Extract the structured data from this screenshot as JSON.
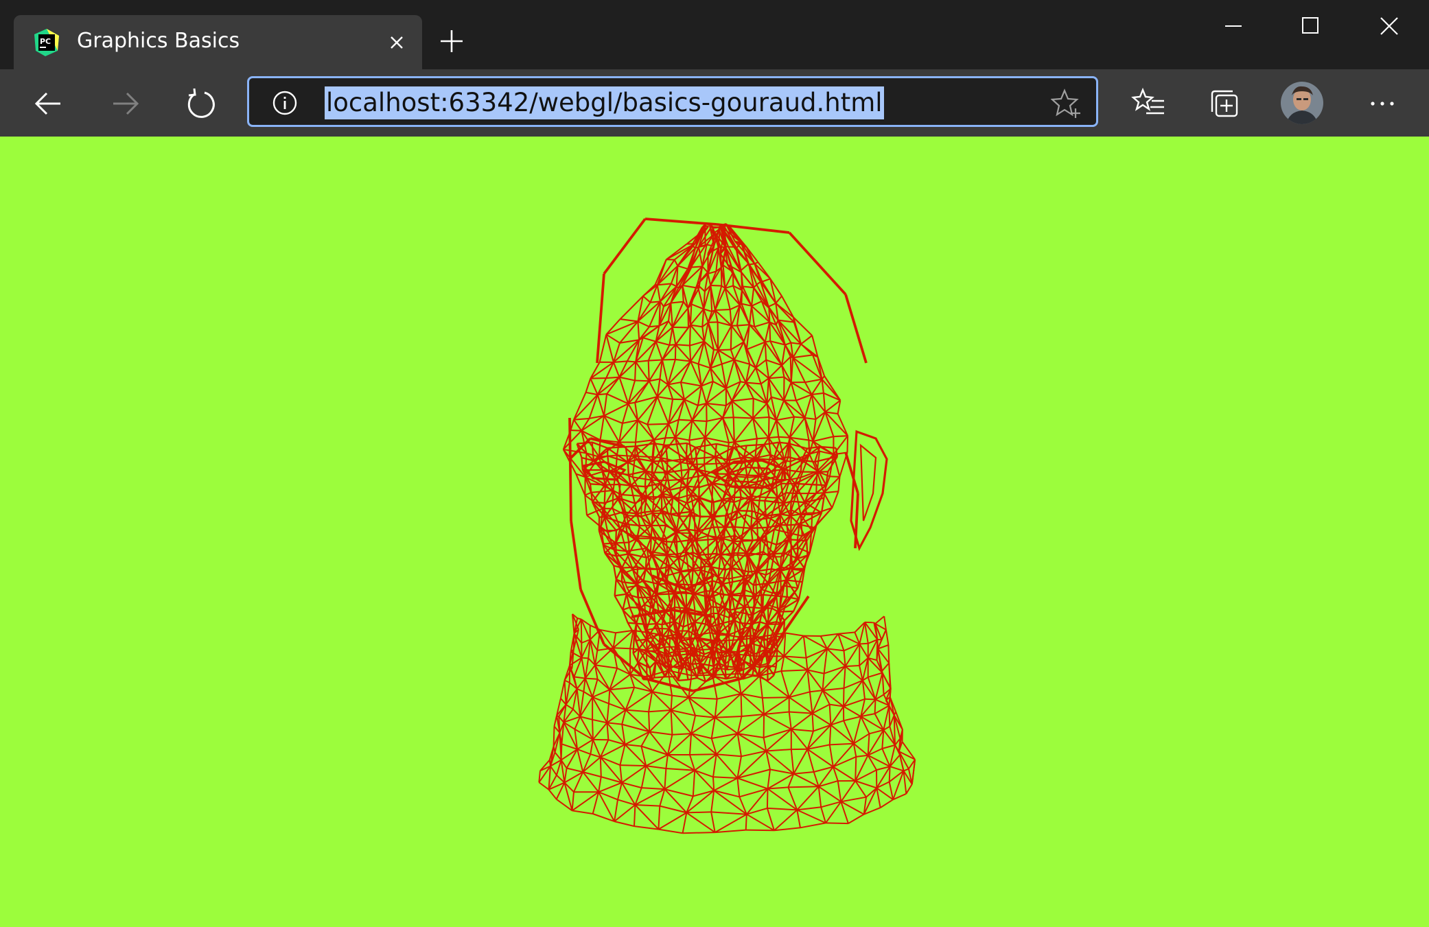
{
  "tab": {
    "title": "Graphics Basics",
    "favicon": "pycharm-icon"
  },
  "addressbar": {
    "url": "localhost:63342/webgl/basics-gouraud.html",
    "info_icon": "info-icon",
    "star_icon": "add-favorite-star-icon"
  },
  "toolbar": {
    "icons": [
      "back-arrow-icon",
      "forward-arrow-icon",
      "refresh-icon",
      "favorites-icon",
      "collections-icon",
      "profile-avatar",
      "more-menu-icon"
    ]
  },
  "canvas": {
    "subject": "wireframe-head",
    "background_color": "#9cfd3c",
    "wire_color": "#d41a00"
  },
  "colors": {
    "titlebar": "#1f1f1f",
    "tab_active": "#3b3b3b",
    "toolbar": "#3b3b3b",
    "address_border": "#8ab4f8",
    "url_selection": "#a8c7fa"
  }
}
